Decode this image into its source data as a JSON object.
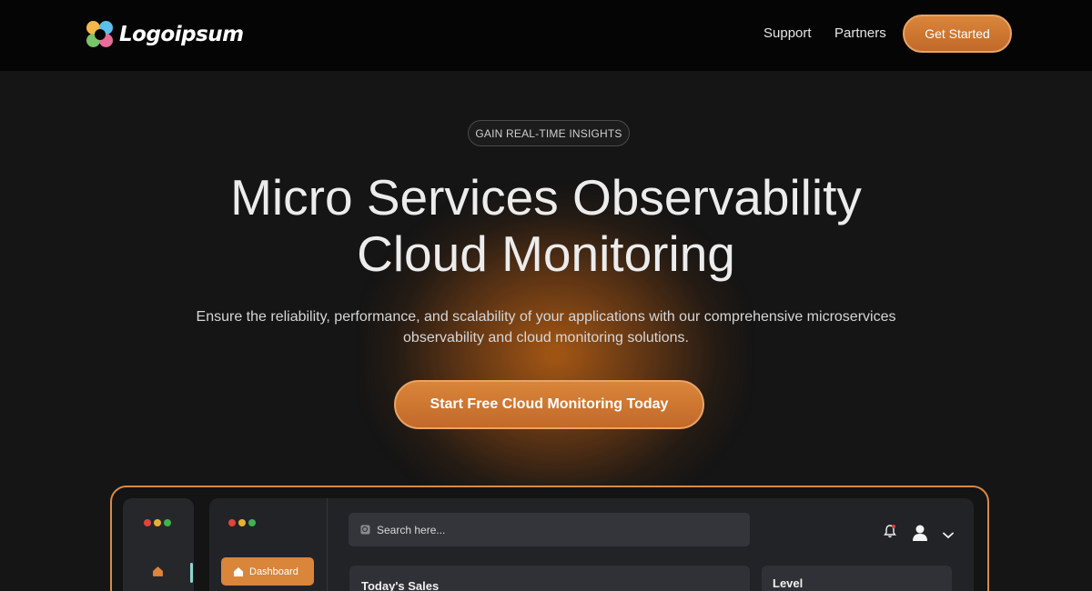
{
  "nav": {
    "brand": "Logoipsum",
    "links": [
      "Support",
      "Partners"
    ],
    "cta_label": "Get Started"
  },
  "hero": {
    "badge": "GAIN REAL-TIME INSIGHTS",
    "title_line1": "Micro Services Observability",
    "title_line2": "Cloud Monitoring",
    "subtitle_line1": "Ensure the reliability, performance, and scalability of your applications with our comprehensive microservices",
    "subtitle_line2": "observability and cloud monitoring solutions.",
    "cta_label": "Start Free Cloud Monitoring Today"
  },
  "dashboard": {
    "window_dots": [
      "#e0443a",
      "#e6b032",
      "#3fb34f"
    ],
    "nav_active_label": "Dashboard",
    "search_placeholder": "Search here...",
    "cards": [
      {
        "title": "Today's Sales"
      },
      {
        "title": "Level"
      }
    ],
    "icons": [
      "home-icon",
      "search-icon",
      "bell-icon",
      "user-icon",
      "chevron-down-icon"
    ]
  },
  "colors": {
    "accent": "#d9853a",
    "background": "#151515",
    "topbar": "#050505"
  }
}
